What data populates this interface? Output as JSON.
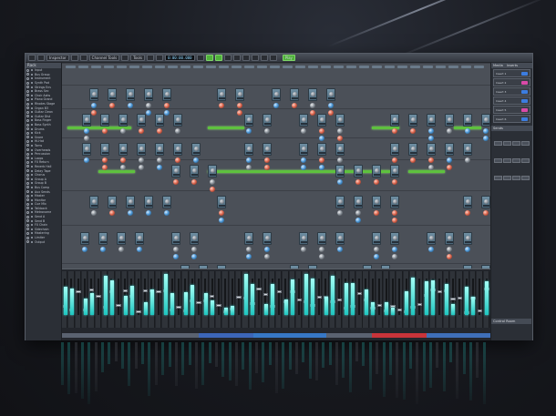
{
  "app": {
    "toolbar": {
      "items": [
        "",
        "",
        "Inspector",
        "",
        "",
        "Channel Tools",
        "",
        "Tools",
        "",
        "",
        "",
        "",
        "",
        "",
        "",
        "",
        "",
        "",
        ""
      ],
      "lcd_time": "0:00:00.000",
      "transport_active": "Play"
    },
    "inspector": {
      "header": "Rack",
      "tree": [
        "Input",
        "Bus Group",
        "Instrument",
        "Synth Pad",
        "Strings Ens",
        "Brass Sec",
        "Choir Aahs",
        "Piano Grand",
        "Rhodes Stage",
        "Organ B3",
        "Guitar Clean",
        "Guitar Dist",
        "Bass Finger",
        "Bass Synth",
        "Drums",
        "Kick",
        "Snare",
        "Hi-Hat",
        "Toms",
        "Overheads",
        "Percussion",
        "Loops",
        "FX Return",
        "Reverb Hall",
        "Delay Tape",
        "Chorus",
        "Group A",
        "Group B",
        "Bus Comp",
        "Aux Sends",
        "Master",
        "Monitor",
        "Cue Mix",
        "Talkback",
        "Metronome",
        "Send A",
        "Send B",
        "FX Chain",
        "Sidechain",
        "Mastering",
        "Limiter",
        "Output"
      ]
    },
    "right_panel": {
      "tabs": [
        "Media",
        "Inserts"
      ],
      "slots": [
        {
          "label": "Insert 1",
          "color": "#3c7de0"
        },
        {
          "label": "Insert 2",
          "color": "#d94aa8"
        },
        {
          "label": "Insert 3",
          "color": "#3c7de0"
        },
        {
          "label": "Insert 4",
          "color": "#3c7de0"
        },
        {
          "label": "Insert 5",
          "color": "#d94aa8"
        },
        {
          "label": "Insert 6",
          "color": "#3c7de0"
        }
      ],
      "section_label": "Sends",
      "bottom_label": "Control Room"
    },
    "mixer": {
      "channel_count": 64
    }
  }
}
